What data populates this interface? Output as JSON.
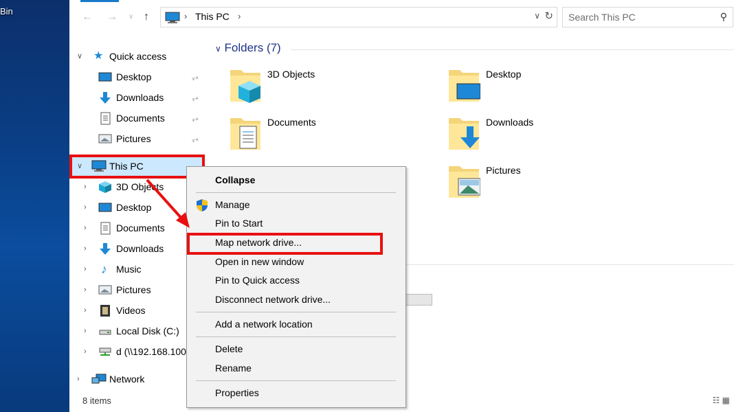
{
  "desktop": {
    "label": "Bin"
  },
  "address_bar": {
    "crumb": "This PC",
    "search_placeholder": "Search This PC"
  },
  "nav_pane": {
    "quick_access": "Quick access",
    "quick_items": [
      {
        "label": "Desktop",
        "icon": "desktop-icon"
      },
      {
        "label": "Downloads",
        "icon": "downloads-icon"
      },
      {
        "label": "Documents",
        "icon": "documents-icon"
      },
      {
        "label": "Pictures",
        "icon": "pictures-icon"
      }
    ],
    "this_pc": "This PC",
    "pc_items": [
      {
        "label": "3D Objects",
        "icon": "3d-objects-icon"
      },
      {
        "label": "Desktop",
        "icon": "desktop-icon"
      },
      {
        "label": "Documents",
        "icon": "documents-icon"
      },
      {
        "label": "Downloads",
        "icon": "downloads-icon"
      },
      {
        "label": "Music",
        "icon": "music-icon"
      },
      {
        "label": "Pictures",
        "icon": "pictures-icon"
      },
      {
        "label": "Videos",
        "icon": "videos-icon"
      },
      {
        "label": "Local Disk (C:)",
        "icon": "local-disk-icon"
      },
      {
        "label": "d (\\\\192.168.100",
        "icon": "network-drive-icon"
      }
    ],
    "network": "Network"
  },
  "content": {
    "group_header": "Folders (7)",
    "folders": [
      {
        "label": "3D Objects",
        "icon": "3d-objects-folder-icon"
      },
      {
        "label": "Desktop",
        "icon": "desktop-folder-icon"
      },
      {
        "label": "Documents",
        "icon": "documents-folder-icon"
      },
      {
        "label": "Downloads",
        "icon": "downloads-folder-icon"
      },
      {
        "label": "Pictures",
        "icon": "pictures-folder-icon"
      }
    ]
  },
  "status_bar": {
    "items": "8 items"
  },
  "context_menu": {
    "items": [
      {
        "label": "Collapse",
        "bold": true
      },
      {
        "label": "Manage",
        "icon": "uac-shield-icon"
      },
      {
        "label": "Pin to Start"
      },
      {
        "label": "Map network drive..."
      },
      {
        "label": "Open in new window"
      },
      {
        "label": "Pin to Quick access"
      },
      {
        "label": "Disconnect network drive..."
      },
      {
        "label": "Add a network location"
      },
      {
        "label": "Delete"
      },
      {
        "label": "Rename"
      },
      {
        "label": "Properties"
      }
    ]
  },
  "colors": {
    "highlight_box": "#e81010",
    "selection": "#cce8ff",
    "group_header": "#1e3287"
  }
}
